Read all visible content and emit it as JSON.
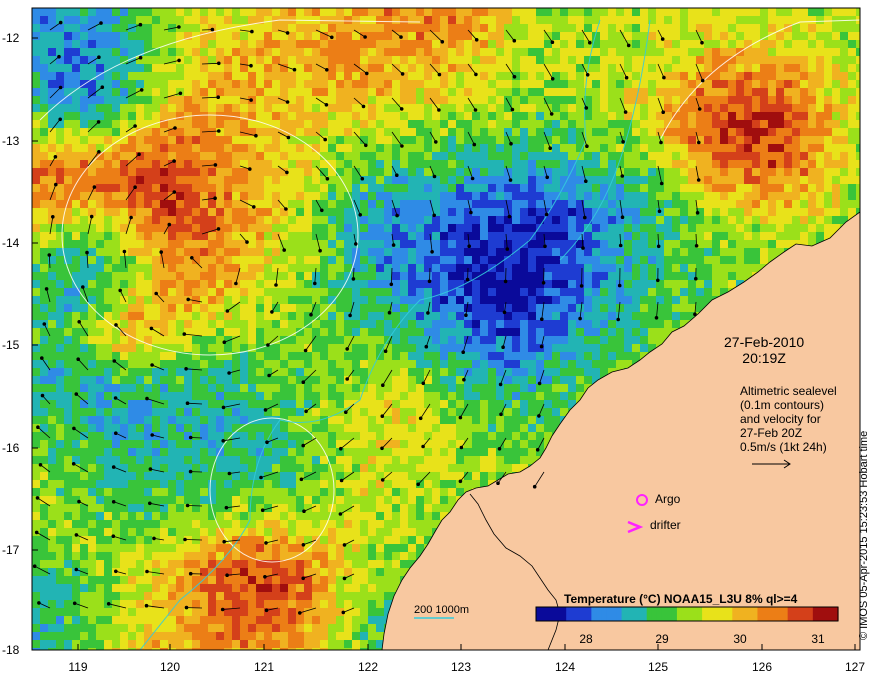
{
  "map": {
    "lon_ticks": [
      "119",
      "120",
      "121",
      "122",
      "123",
      "124",
      "125",
      "126",
      "127"
    ],
    "lat_ticks": [
      "-12",
      "-13",
      "-14",
      "-15",
      "-16",
      "-17",
      "-18"
    ],
    "ocean_palette": [
      "#0a0a9a",
      "#1e3cd2",
      "#2f8be6",
      "#22b4b4",
      "#39c43a",
      "#9be01a",
      "#e8e21a",
      "#f0b220",
      "#ec7e16",
      "#d4401a",
      "#a00e0e"
    ],
    "land_color": "#f8c8a0"
  },
  "annotations": {
    "date": "27-Feb-2010",
    "time": "20:19Z",
    "altimetry_lines": [
      "Altimetric sealevel",
      "(0.1m contours)",
      "and velocity for",
      "27-Feb 20Z",
      "0.5m/s (1kt 24h)"
    ],
    "argo": "Argo",
    "drifter": "drifter",
    "depth_contours": "200  1000m",
    "credit": "© IMOS 05-Apr-2015 15:23:53 Hobart time"
  },
  "colorbar": {
    "title": "Temperature (°C) NOAA15_L3U 8% ql>=4",
    "ticks": [
      "28",
      "29",
      "30",
      "31"
    ],
    "colors": [
      "#0a0a9a",
      "#1e3cd2",
      "#2f8be6",
      "#22b4b4",
      "#39c43a",
      "#9be01a",
      "#e8e21a",
      "#f0b220",
      "#ec7e16",
      "#d4401a",
      "#a00e0e"
    ]
  }
}
